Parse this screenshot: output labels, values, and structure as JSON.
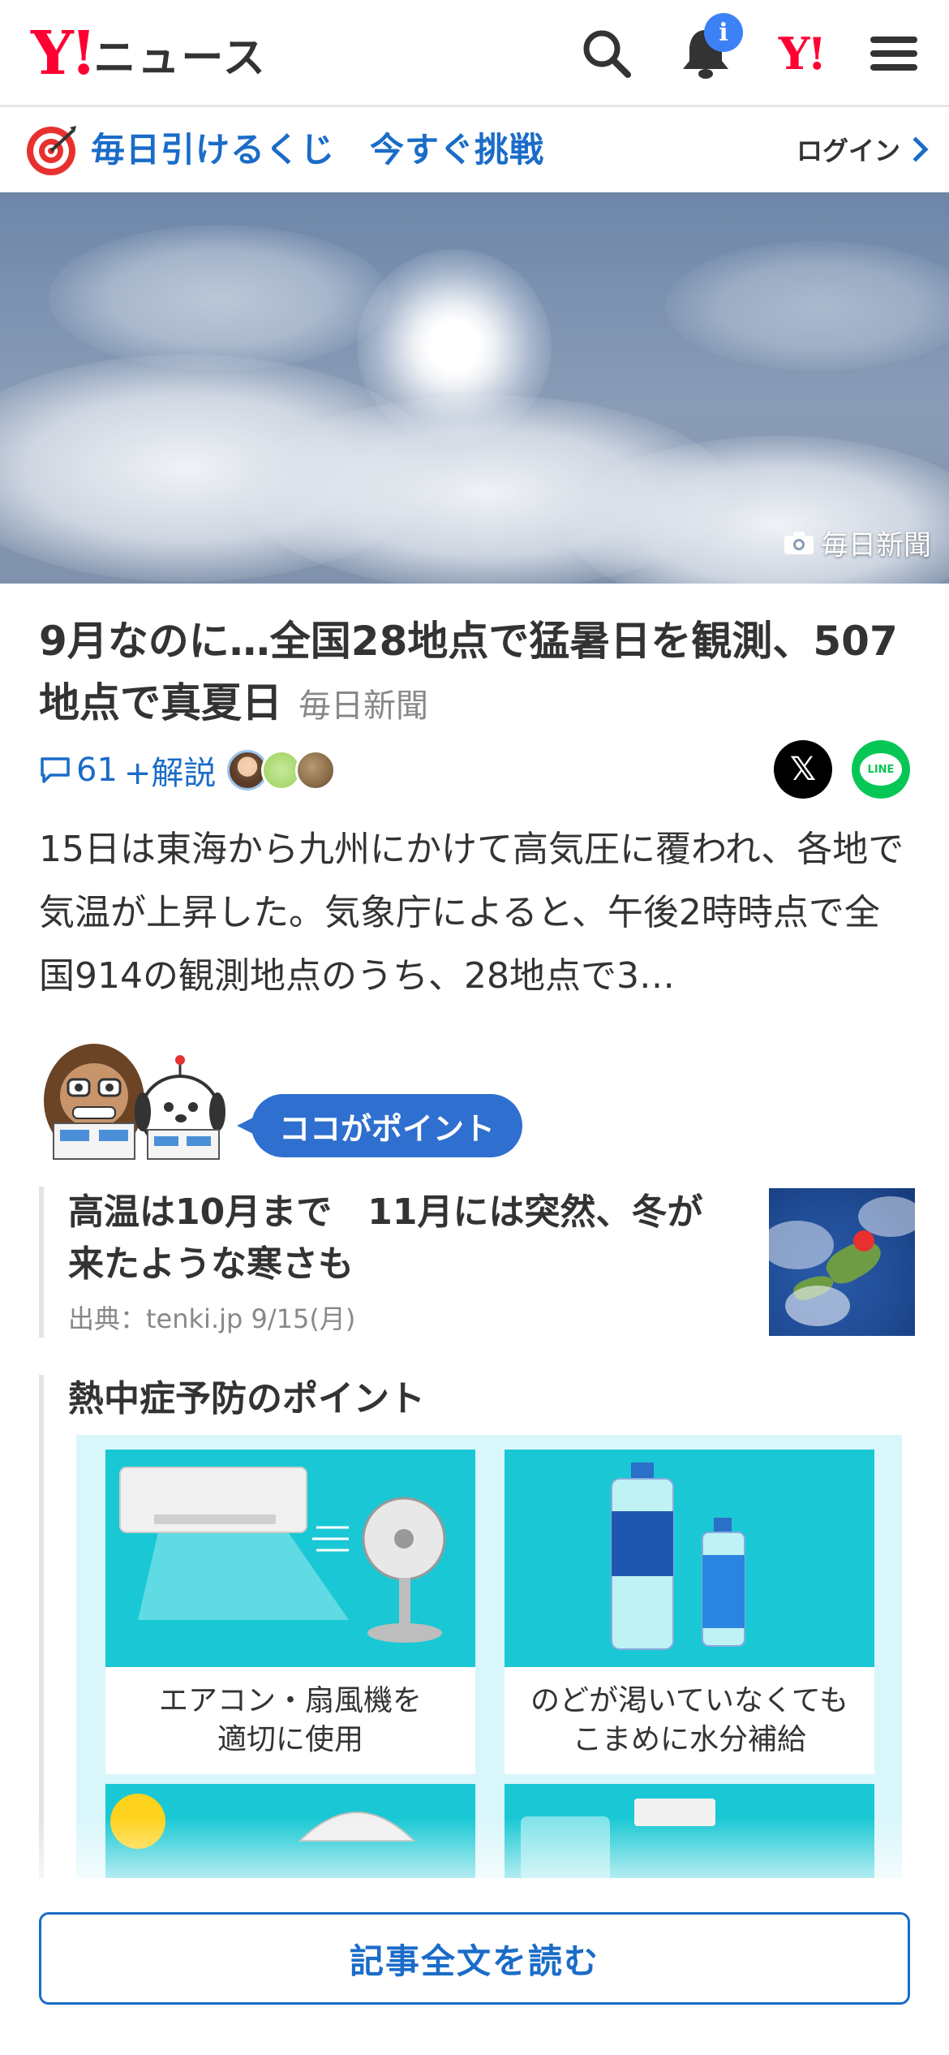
{
  "header": {
    "logo_mark": "Y!",
    "logo_text": "ニュース",
    "notification_badge": "i",
    "yahoo_japan_mark": "Y!"
  },
  "promo": {
    "text": "毎日引けるくじ　今すぐ挑戦",
    "login_label": "ログイン"
  },
  "hero": {
    "photo_credit": "毎日新聞"
  },
  "article": {
    "title": "9月なのに…全国28地点で猛暑日を観測、507地点で真夏日",
    "source": "毎日新聞",
    "comment_count": "61",
    "commentary_label": "+解説",
    "summary": "15日は東海から九州にかけて高気圧に覆われ、各地で気温が上昇した。気象庁によると、午後2時時点で全国914の観測地点のうち、28地点で3…"
  },
  "share": {
    "x_label": "𝕏",
    "line_label": "LINE"
  },
  "point": {
    "badge": "ココがポイント",
    "related_title": "高温は10月まで　11月には突然、冬が来たような寒さも",
    "related_source": "出典：tenki.jp 9/15(月)"
  },
  "heatstroke": {
    "title": "熱中症予防のポイント",
    "tiles": [
      {
        "caption_line1": "エアコン・扇風機を",
        "caption_line2": "適切に使用"
      },
      {
        "caption_line1": "のどが渇いていなくても",
        "caption_line2": "こまめに水分補給"
      }
    ]
  },
  "read_more": {
    "label": "記事全文を読む"
  },
  "colors": {
    "brand_red": "#ff0033",
    "link_blue": "#1a6cc8",
    "point_blue": "#2f6fcf",
    "line_green": "#06c755",
    "tile_cyan": "#19c8d4"
  }
}
